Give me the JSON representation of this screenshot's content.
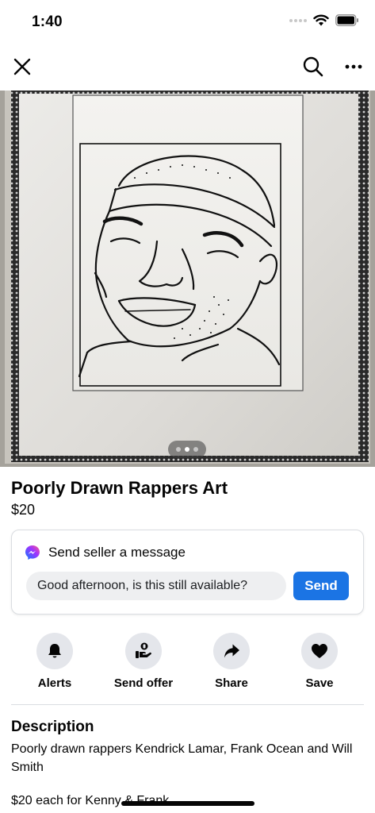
{
  "status_bar": {
    "time": "1:40"
  },
  "nav": {
    "close_icon": "close-icon",
    "search_icon": "search-icon",
    "more_icon": "more-icon"
  },
  "hero": {
    "image_subject": "framed line drawing of a smiling man wearing a headband",
    "photo_count": 3,
    "active_photo": 2
  },
  "listing": {
    "title": "Poorly Drawn Rappers Art",
    "price": "$20"
  },
  "message_card": {
    "heading": "Send seller a message",
    "input_value": "Good afternoon, is this still available?",
    "send_label": "Send",
    "messenger_icon": "messenger-icon"
  },
  "actions": [
    {
      "label": "Alerts",
      "icon": "bell-icon"
    },
    {
      "label": "Send offer",
      "icon": "offer-icon"
    },
    {
      "label": "Share",
      "icon": "share-icon"
    },
    {
      "label": "Save",
      "icon": "heart-icon"
    }
  ],
  "description": {
    "heading": "Description",
    "body": "Poorly drawn rappers Kendrick Lamar, Frank Ocean and Will Smith",
    "extra": "$20 each for Kenny & Frank"
  },
  "colors": {
    "accent": "#1b74e4",
    "action_bg": "#e4e6eb",
    "input_bg": "#eeeff1",
    "divider": "#dadde1"
  }
}
